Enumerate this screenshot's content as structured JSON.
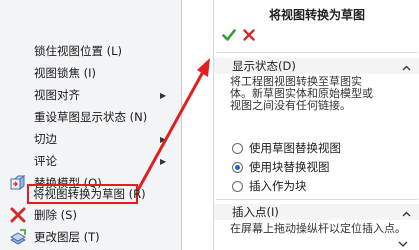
{
  "menu": {
    "items": [
      {
        "label": "锁住视图位置 (L)",
        "icon": "none",
        "submenu": false
      },
      {
        "label": "视图锁焦 (I)",
        "icon": "none",
        "submenu": false
      },
      {
        "label": "视图对齐",
        "icon": "none",
        "submenu": true
      },
      {
        "label": "重设草图显示状态 (N)",
        "icon": "none",
        "submenu": false
      },
      {
        "label": "切边",
        "icon": "none",
        "submenu": true
      },
      {
        "label": "评论",
        "icon": "none",
        "submenu": true
      },
      {
        "label": "替换模型 (Q)",
        "icon": "replace-model-icon",
        "submenu": false
      },
      {
        "label": "将视图转换为草图 (R)",
        "icon": "none",
        "submenu": false
      },
      {
        "label": "删除 (S)",
        "icon": "delete-icon",
        "submenu": false
      },
      {
        "label": "更改图层 (T)",
        "icon": "change-layer-icon",
        "submenu": false
      }
    ]
  },
  "panel": {
    "title": "将视图转换为草图",
    "ok_icon": "checkmark-icon",
    "cancel_icon": "close-icon",
    "display_state": {
      "title": "显示状态(D)",
      "description": [
        "将工程图视图转换至草图实",
        "体。新草图实体和原始模型或",
        "视图之间没有任何链接。"
      ],
      "options": [
        {
          "label": "使用草图替换视图",
          "checked": false
        },
        {
          "label": "使用块替换视图",
          "checked": true
        },
        {
          "label": "插入作为块",
          "checked": false
        }
      ]
    },
    "insertion_point": {
      "title": "插入点(I)",
      "description": "在屏幕上拖动操纵杆以定位插入点。"
    }
  },
  "colors": {
    "accent": "#1e64c8",
    "highlight_border": "#e02020",
    "ok_green": "#2e9e3a",
    "cancel_red": "#d22d2d",
    "menu_bg": "#f3f4f6"
  }
}
